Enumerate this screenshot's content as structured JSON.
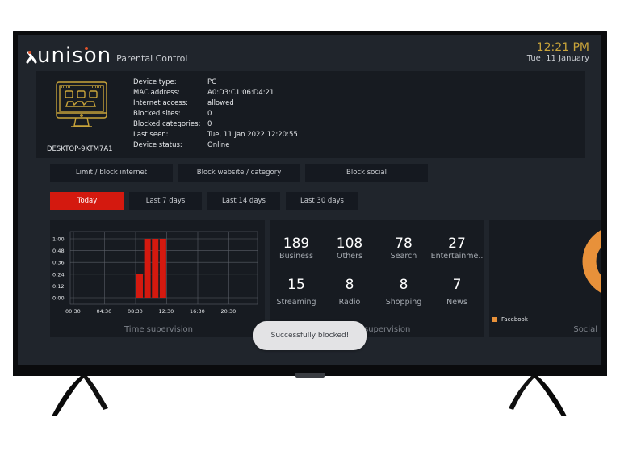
{
  "app": {
    "brand": "unison",
    "subtitle": "Parental Control"
  },
  "clock": {
    "time": "12:21 PM",
    "date": "Tue, 11 January"
  },
  "device": {
    "name": "DESKTOP-9KTM7A1",
    "icon": "desktop-computer-icon",
    "fields": [
      {
        "label": "Device type:",
        "value": "PC"
      },
      {
        "label": "MAC address:",
        "value": "A0:D3:C1:06:D4:21"
      },
      {
        "label": "Internet access:",
        "value": "allowed"
      },
      {
        "label": "Blocked sites:",
        "value": "0"
      },
      {
        "label": "Blocked categories:",
        "value": "0"
      },
      {
        "label": "Last seen:",
        "value": "Tue, 11 Jan 2022 12:20:55"
      },
      {
        "label": "Device status:",
        "value": "Online"
      }
    ]
  },
  "actions": [
    {
      "label": "Limit / block internet"
    },
    {
      "label": "Block website / category"
    },
    {
      "label": "Block social"
    }
  ],
  "periods": [
    {
      "label": "Today",
      "active": true
    },
    {
      "label": "Last 7 days",
      "active": false
    },
    {
      "label": "Last 14 days",
      "active": false
    },
    {
      "label": "Last 30 days",
      "active": false
    }
  ],
  "panels": {
    "time": {
      "title": "Time supervision"
    },
    "web": {
      "title": "Web supervision"
    },
    "social": {
      "title": "Social"
    }
  },
  "chart_data": {
    "type": "bar",
    "title": "Time supervision",
    "xlabel": "",
    "ylabel": "",
    "x_ticks": [
      "00:30",
      "04:30",
      "08:30",
      "12:30",
      "16:30",
      "20:30"
    ],
    "y_ticks": [
      "0:00",
      "0:12",
      "0:24",
      "0:36",
      "0:48",
      "1:00"
    ],
    "ylim_minutes": [
      0,
      60
    ],
    "categories": [
      "08:30",
      "09:30",
      "10:30",
      "11:30"
    ],
    "values_minutes": [
      24,
      60,
      60,
      60
    ],
    "color": "#d4190f",
    "grid": true
  },
  "web_stats": [
    {
      "value": "189",
      "label": "Business"
    },
    {
      "value": "108",
      "label": "Others"
    },
    {
      "value": "78",
      "label": "Search"
    },
    {
      "value": "27",
      "label": "Entertainme.."
    },
    {
      "value": "15",
      "label": "Streaming"
    },
    {
      "value": "8",
      "label": "Radio"
    },
    {
      "value": "8",
      "label": "Shopping"
    },
    {
      "value": "7",
      "label": "News"
    }
  ],
  "social_chart": {
    "type": "pie",
    "legend": [
      {
        "label": "Facebook",
        "color": "#e8913a"
      }
    ],
    "values": [
      100
    ]
  },
  "toast": {
    "message": "Successfully blocked!"
  },
  "colors": {
    "accent_red": "#d4190f",
    "gold": "#c9a43a",
    "orange": "#e8913a"
  }
}
